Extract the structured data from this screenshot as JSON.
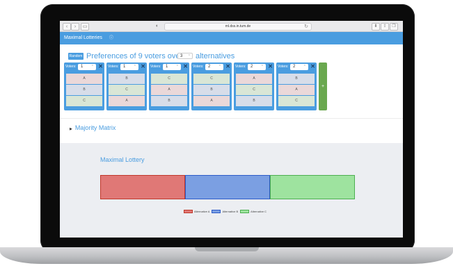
{
  "browser": {
    "url": "ml.dss.in.tum.de",
    "back_icon": "‹",
    "forward_icon": "›"
  },
  "app": {
    "title": "Maximal Lotteries",
    "info_icon": "ⓘ"
  },
  "preferences": {
    "random_label": "Random",
    "heading_prefix": "Preferences of 9 voters over",
    "alternatives_count": "3",
    "heading_suffix": "alternatives",
    "voters_label": "Voters:",
    "close_glyph": "✕",
    "add_glyph": "+",
    "ballots": [
      {
        "count": "1",
        "ranking": [
          "A",
          "B",
          "C"
        ]
      },
      {
        "count": "1",
        "ranking": [
          "B",
          "C",
          "A"
        ]
      },
      {
        "count": "1",
        "ranking": [
          "C",
          "A",
          "B"
        ]
      },
      {
        "count": "2",
        "ranking": [
          "C",
          "B",
          "A"
        ]
      },
      {
        "count": "2",
        "ranking": [
          "A",
          "C",
          "B"
        ]
      },
      {
        "count": "2",
        "ranking": [
          "B",
          "A",
          "C"
        ]
      }
    ]
  },
  "majority": {
    "toggle_glyph": "▶",
    "label": "Majority Matrix"
  },
  "lottery": {
    "title": "Maximal Lottery",
    "probabilities": [
      {
        "alt": "Alternative A",
        "value": 0.3333,
        "color": "#e07876",
        "border": "#c0392b"
      },
      {
        "alt": "Alternative B",
        "value": 0.3333,
        "color": "#7b9fe2",
        "border": "#2e5cc9"
      },
      {
        "alt": "Alternative C",
        "value": 0.3334,
        "color": "#9ee39f",
        "border": "#4caf50"
      }
    ]
  }
}
